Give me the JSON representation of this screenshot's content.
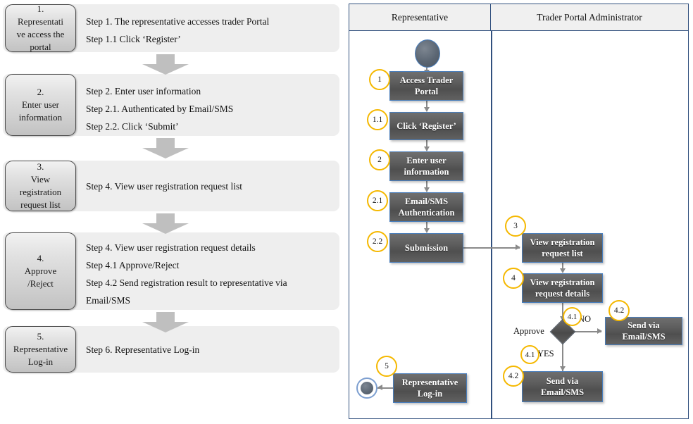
{
  "left_panel": {
    "steps": [
      {
        "box_label": "1.\nRepresentati\nve access the\nportal",
        "lines": [
          "Step 1. The representative accesses trader Portal",
          "Step 1.1 Click ‘Register’"
        ]
      },
      {
        "box_label": "2.\nEnter user\ninformation",
        "lines": [
          "Step 2.   Enter user information",
          "Step 2.1. Authenticated by Email/SMS",
          "Step 2.2. Click  ‘Submit’"
        ]
      },
      {
        "box_label": "3.\nView\nregistration\nrequest list",
        "lines": [
          "Step 4. View user registration request list"
        ]
      },
      {
        "box_label": "4.\nApprove\n/Reject",
        "lines": [
          "Step 4. View user registration request details",
          "Step 4.1 Approve/Reject",
          "Step 4.2 Send registration result to representative via",
          "Email/SMS"
        ]
      },
      {
        "box_label": "5.\nRepresentative\nLog-in",
        "lines": [
          "Step 6. Representative Log-in"
        ]
      }
    ]
  },
  "flow_panel": {
    "lanes": {
      "left": "Representative",
      "right": "Trader Portal Administrator"
    },
    "nodes": {
      "access_trader_portal": "Access Trader\nPortal",
      "click_register": "Click ‘Register’",
      "enter_user_information": "Enter  user\ninformation",
      "email_sms_authentication": "Email/SMS\nAuthentication",
      "submission": "Submission",
      "view_registration_request_list": "View registration\nrequest list",
      "view_registration_request_details": "View registration\nrequest details",
      "send_via_email_sms_no": "Send via\nEmail/SMS",
      "send_via_email_sms_yes": "Send via\nEmail/SMS",
      "representative_login": "Representative\nLog-in"
    },
    "badges": {
      "b1": "1",
      "b11": "1.1",
      "b2": "2",
      "b21": "2.1",
      "b22": "2.2",
      "b3": "3",
      "b4": "4",
      "b41_no": "4.1",
      "b42_no": "4.2",
      "b41_yes": "4.1",
      "b42_yes": "4.2",
      "b5": "5"
    },
    "labels": {
      "approve": "Approve",
      "no": "NO",
      "yes": "YES"
    },
    "colors": {
      "lane_border": "#31507e",
      "node_fill": "#595959",
      "node_border": "#4a7ebb",
      "badge_border": "#f5b800",
      "connector": "#8a8a8a"
    }
  }
}
